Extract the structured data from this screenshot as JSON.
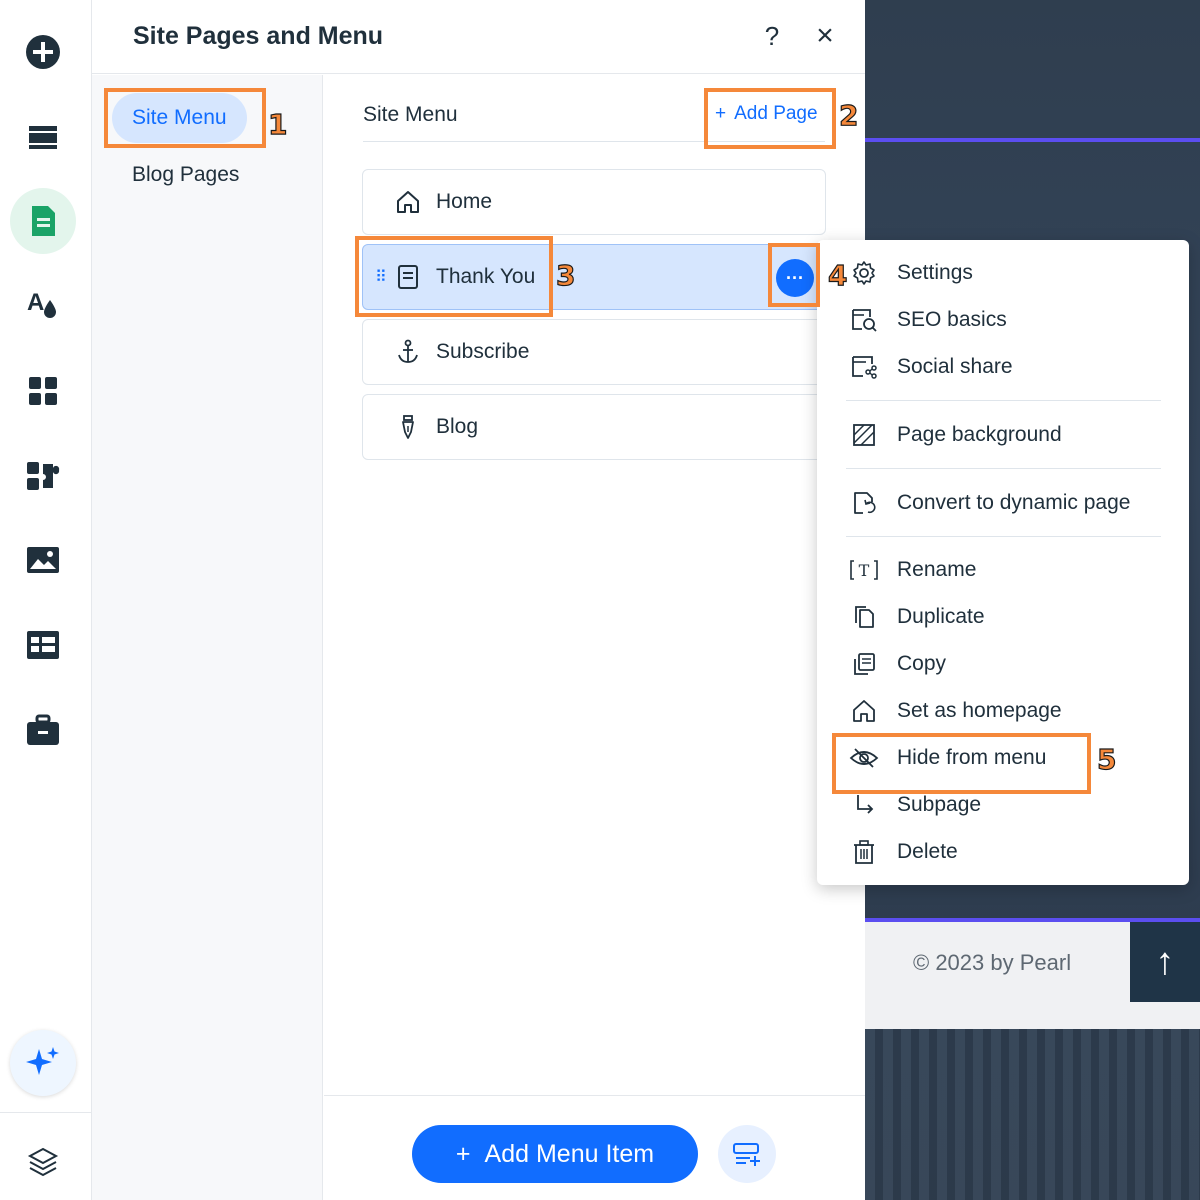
{
  "panel": {
    "title": "Site Pages and Menu",
    "help_label": "?",
    "close_label": "×"
  },
  "nav": {
    "items": [
      {
        "label": "Site Menu",
        "selected": true
      },
      {
        "label": "Blog Pages",
        "selected": false
      }
    ]
  },
  "main": {
    "title": "Site Menu",
    "add_page_icon": "+",
    "add_page_label": "Add Page",
    "pages": [
      {
        "label": "Home",
        "icon": "home-icon"
      },
      {
        "label": "Thank You",
        "icon": "page-icon",
        "selected": true
      },
      {
        "label": "Subscribe",
        "icon": "anchor-icon"
      },
      {
        "label": "Blog",
        "icon": "pen-icon"
      }
    ],
    "more_label": "···",
    "drag_label": "⠿"
  },
  "bottom": {
    "add_menu_item_icon": "+",
    "add_menu_item_label": "Add Menu Item"
  },
  "context_menu": {
    "items": [
      {
        "label": "Settings",
        "icon": "gear-icon"
      },
      {
        "label": "SEO basics",
        "icon": "seo-icon"
      },
      {
        "label": "Social share",
        "icon": "social-share-icon"
      },
      {
        "label": "Page background",
        "icon": "background-icon"
      },
      {
        "label": "Convert to dynamic page",
        "icon": "dynamic-page-icon"
      },
      {
        "label": "Rename",
        "icon": "rename-icon"
      },
      {
        "label": "Duplicate",
        "icon": "duplicate-icon"
      },
      {
        "label": "Copy",
        "icon": "copy-icon"
      },
      {
        "label": "Set as homepage",
        "icon": "home-icon"
      },
      {
        "label": "Hide from menu",
        "icon": "eye-hidden-icon"
      },
      {
        "label": "Subpage",
        "icon": "subpage-icon"
      },
      {
        "label": "Delete",
        "icon": "trash-icon"
      }
    ]
  },
  "preview": {
    "copyright": "© 2023 by Pearl",
    "up_arrow": "↑"
  },
  "annotations": [
    "1",
    "2",
    "3",
    "4",
    "5"
  ],
  "colors": {
    "accent": "#116dff",
    "highlight": "#f5883a",
    "selected_bg": "#d6e6fe",
    "rail_active_bg": "#e3f5ec",
    "rail_active_icon": "#1aa367"
  }
}
